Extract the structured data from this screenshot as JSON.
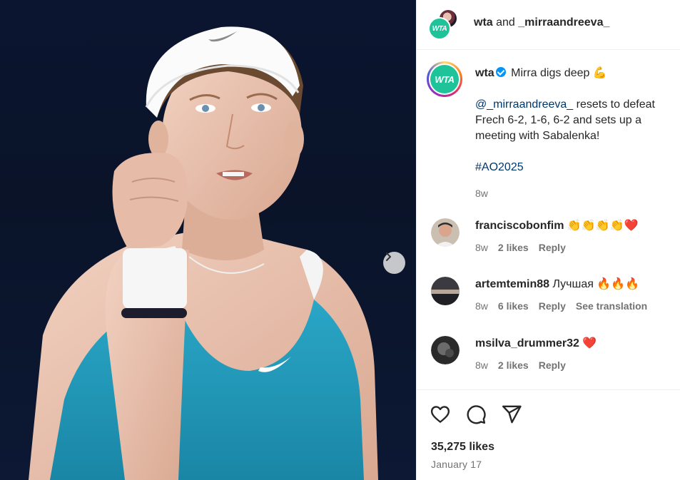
{
  "header": {
    "user_primary": "wta",
    "joiner": "and",
    "user_secondary": "_mirraandreeva_",
    "avatar_text": "WTA"
  },
  "caption": {
    "avatar_text": "WTA",
    "username": "wta",
    "title_text": "Mirra digs deep",
    "title_emoji": "💪",
    "mention": "@_mirraandreeva_",
    "body": " resets to defeat Frech 6-2, 1-6, 6-2 and sets up a meeting with Sabalenka!",
    "hashtag": "#AO2025",
    "time": "8w"
  },
  "comments": [
    {
      "username": "franciscobonfim",
      "text": "👏👏👏👏❤️",
      "time": "8w",
      "likes": "2 likes",
      "reply": "Reply",
      "translation": ""
    },
    {
      "username": "artemtemin88",
      "text": "Лучшая 🔥🔥🔥",
      "time": "8w",
      "likes": "6 likes",
      "reply": "Reply",
      "translation": "See translation"
    },
    {
      "username": "msilva_drummer32",
      "text": "❤️",
      "time": "8w",
      "likes": "2 likes",
      "reply": "Reply",
      "translation": ""
    }
  ],
  "footer": {
    "likes": "35,275 likes",
    "date": "January 17"
  },
  "colors": {
    "wta_brand": "#1ec39a",
    "verified": "#0095f6",
    "link": "#00376b",
    "muted": "#737373",
    "shirt": "#1e94b4"
  }
}
